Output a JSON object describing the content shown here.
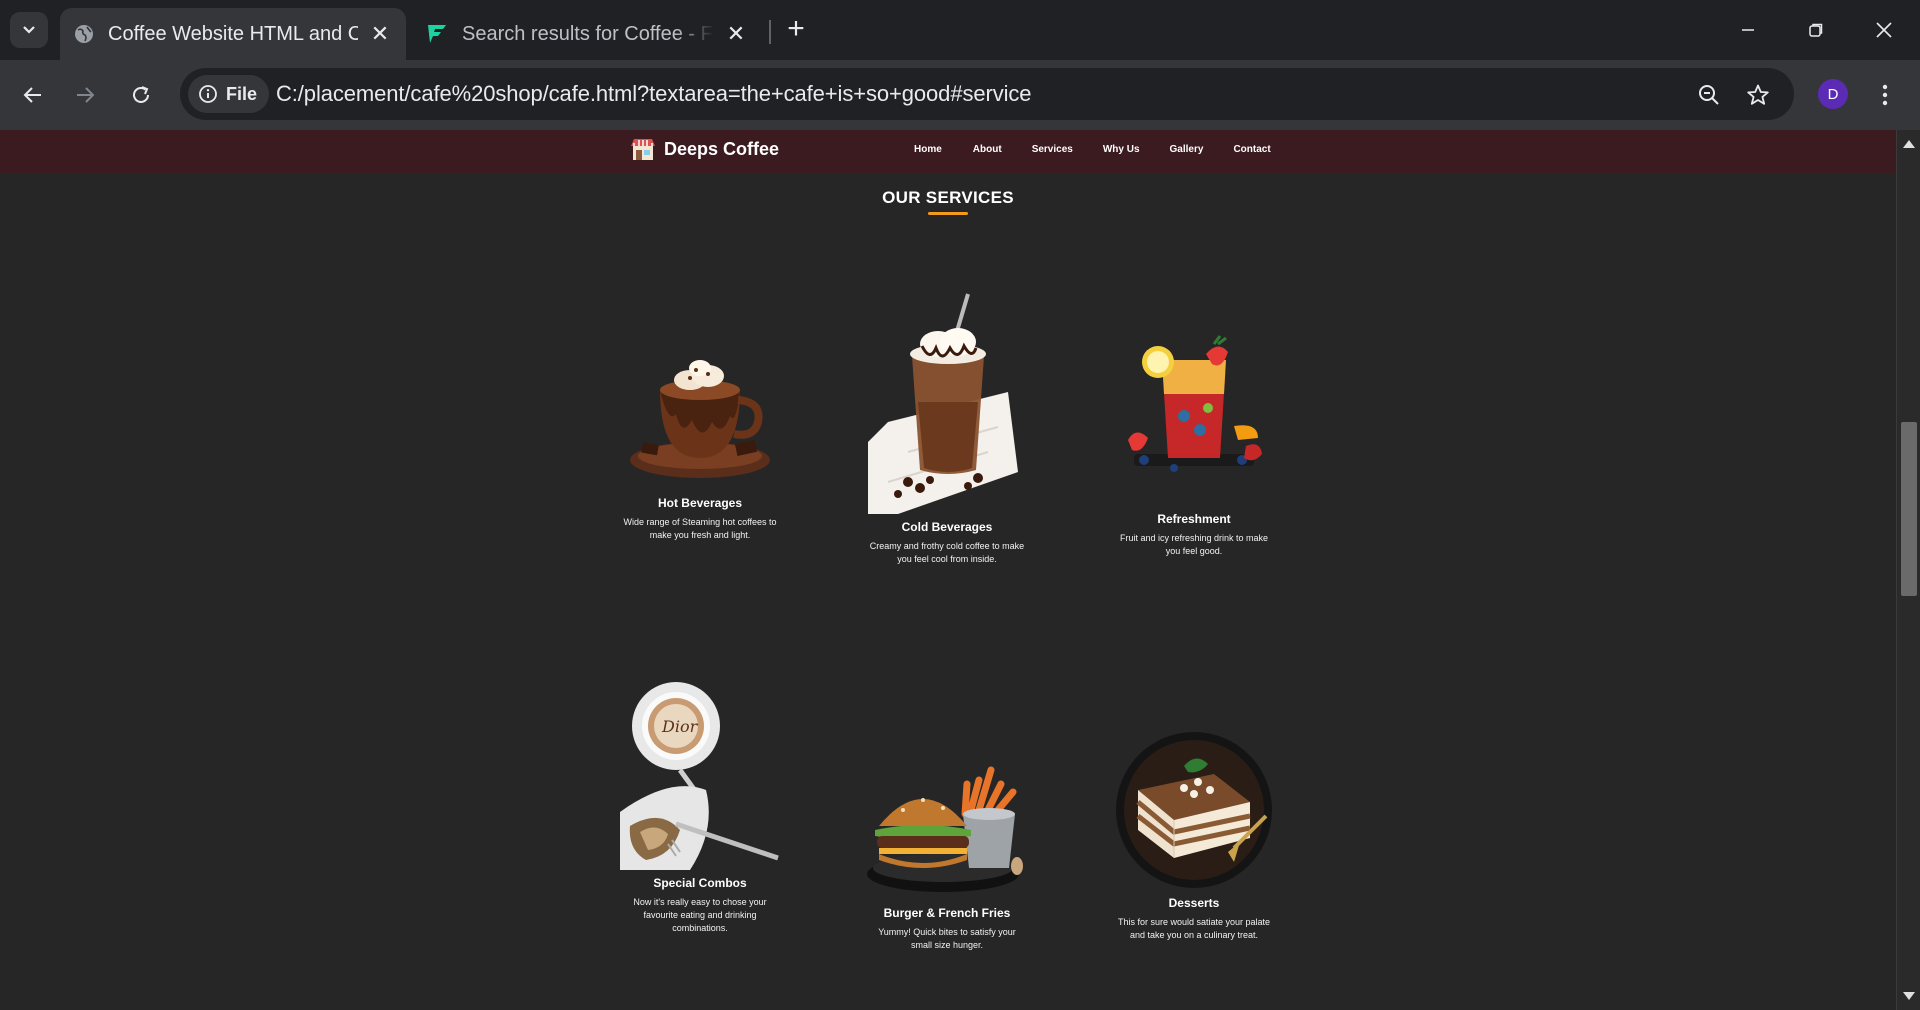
{
  "browser": {
    "tabs": [
      {
        "title": "Coffee Website HTML and CSS",
        "active": true,
        "icon": "globe-icon"
      },
      {
        "title": "Search results for Coffee - Flaticon",
        "active": false,
        "icon": "flaticon-logo-icon"
      }
    ],
    "address_chip": "File",
    "url": "C:/placement/cafe%20shop/cafe.html?textarea=the+cafe+is+so+good#service",
    "profile_initial": "D"
  },
  "site": {
    "brand": "Deeps Coffee",
    "nav": [
      "Home",
      "About",
      "Services",
      "Why Us",
      "Gallery",
      "Contact"
    ],
    "section_title": "OUR SERVICES",
    "accent": "#f29b1c",
    "nav_bg": "#3b1a20",
    "services": [
      {
        "title": "Hot Beverages",
        "desc": "Wide range of Steaming hot coffees to make you fresh and light.",
        "icon": "hot-chocolate-image"
      },
      {
        "title": "Cold Beverages",
        "desc": "Creamy and frothy cold coffee to make you feel cool from inside.",
        "icon": "iced-coffee-image"
      },
      {
        "title": "Refreshment",
        "desc": "Fruit and icy refreshing drink to make you feel good.",
        "icon": "fruit-drink-image"
      },
      {
        "title": "Special Combos",
        "desc": "Now it's really easy to chose your favourite eating and drinking combinations.",
        "icon": "coffee-and-cake-image"
      },
      {
        "title": "Burger & French Fries",
        "desc": "Yummy! Quick bites to satisfy your small size hunger.",
        "icon": "burger-fries-image"
      },
      {
        "title": "Desserts",
        "desc": "This for sure would satiate your palate and take you on a culinary treat.",
        "icon": "tiramisu-image"
      }
    ]
  }
}
